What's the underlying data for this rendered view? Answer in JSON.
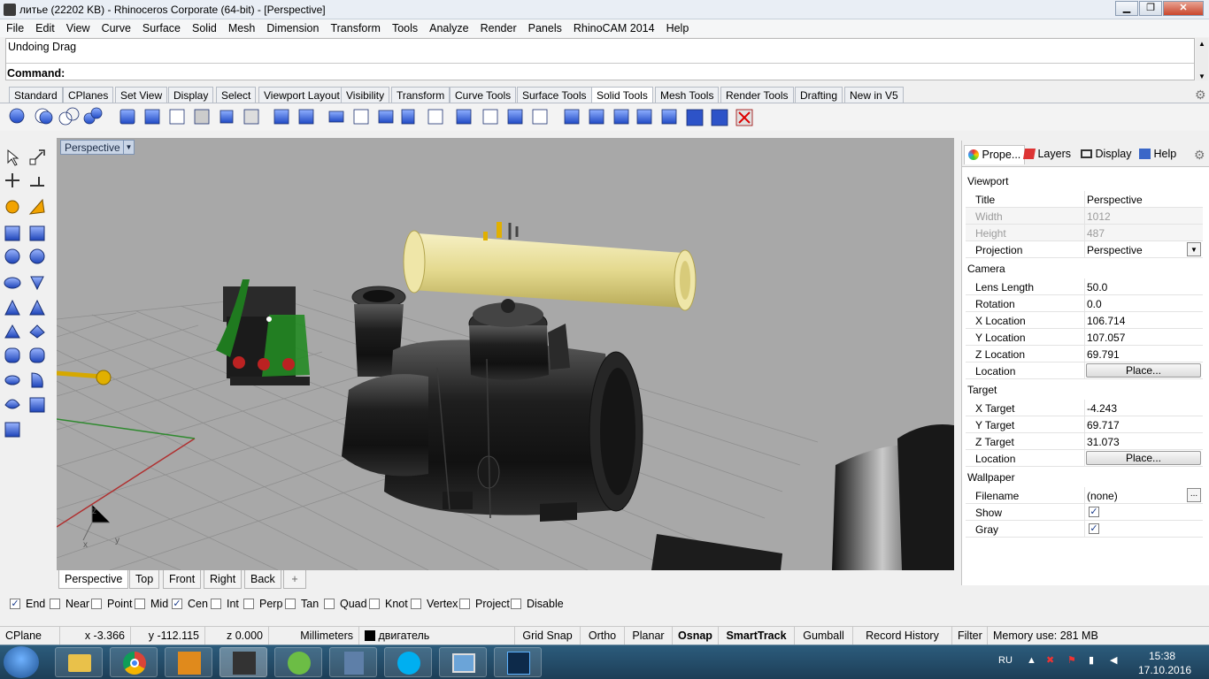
{
  "window": {
    "title": "литье (22202 KB) - Rhinoceros Corporate (64-bit) - [Perspective]",
    "controls": [
      "minimize",
      "maximize",
      "close"
    ]
  },
  "menu": [
    "File",
    "Edit",
    "View",
    "Curve",
    "Surface",
    "Solid",
    "Mesh",
    "Dimension",
    "Transform",
    "Tools",
    "Analyze",
    "Render",
    "Panels",
    "RhinoCAM 2014",
    "Help"
  ],
  "command": {
    "history": "Undoing Drag",
    "prompt": "Command:"
  },
  "toolbar_tabs": [
    "Standard",
    "CPlanes",
    "Set View",
    "Display",
    "Select",
    "Viewport Layout",
    "Visibility",
    "Transform",
    "Curve Tools",
    "Surface Tools",
    "Solid Tools",
    "Mesh Tools",
    "Render Tools",
    "Drafting",
    "New in V5"
  ],
  "active_toolbar_tab": "Solid Tools",
  "viewport": {
    "title": "Perspective",
    "tabs": [
      "Perspective",
      "Top",
      "Front",
      "Right",
      "Back"
    ],
    "active_tab": "Perspective",
    "add_tab_glyph": "+",
    "axis_labels": {
      "z": "z",
      "y": "y",
      "x": "x"
    }
  },
  "panel": {
    "tabs": [
      "Prope...",
      "Layers",
      "Display",
      "Help"
    ],
    "sections": {
      "viewport": {
        "header": "Viewport",
        "title_label": "Title",
        "title_value": "Perspective",
        "width_label": "Width",
        "width_value": "1012",
        "height_label": "Height",
        "height_value": "487",
        "projection_label": "Projection",
        "projection_value": "Perspective"
      },
      "camera": {
        "header": "Camera",
        "lens_label": "Lens Length",
        "lens_value": "50.0",
        "rotation_label": "Rotation",
        "rotation_value": "0.0",
        "x_label": "X Location",
        "x_value": "106.714",
        "y_label": "Y Location",
        "y_value": "107.057",
        "z_label": "Z Location",
        "z_value": "69.791",
        "location_label": "Location",
        "place_button": "Place..."
      },
      "target": {
        "header": "Target",
        "x_label": "X Target",
        "x_value": "-4.243",
        "y_label": "Y Target",
        "y_value": "69.717",
        "z_label": "Z Target",
        "z_value": "31.073",
        "location_label": "Location",
        "place_button": "Place..."
      },
      "wallpaper": {
        "header": "Wallpaper",
        "filename_label": "Filename",
        "filename_value": "(none)",
        "browse_button": "...",
        "show_label": "Show",
        "show_checked": true,
        "gray_label": "Gray",
        "gray_checked": true
      }
    }
  },
  "osnap": [
    {
      "label": "End",
      "checked": true
    },
    {
      "label": "Near",
      "checked": false
    },
    {
      "label": "Point",
      "checked": false
    },
    {
      "label": "Mid",
      "checked": false
    },
    {
      "label": "Cen",
      "checked": true
    },
    {
      "label": "Int",
      "checked": false
    },
    {
      "label": "Perp",
      "checked": false
    },
    {
      "label": "Tan",
      "checked": false
    },
    {
      "label": "Quad",
      "checked": false
    },
    {
      "label": "Knot",
      "checked": false
    },
    {
      "label": "Vertex",
      "checked": false
    },
    {
      "label": "Project",
      "checked": false
    },
    {
      "label": "Disable",
      "checked": false
    }
  ],
  "status": {
    "cplane": "CPlane",
    "x": "x -3.366",
    "y": "y -112.115",
    "z": "z 0.000",
    "units": "Millimeters",
    "layer": "двигатель",
    "grid_snap": "Grid Snap",
    "ortho": "Ortho",
    "planar": "Planar",
    "osnap": "Osnap",
    "smarttrack": "SmartTrack",
    "gumball": "Gumball",
    "record_history": "Record History",
    "filter": "Filter",
    "memory": "Memory use: 281 MB"
  },
  "taskbar": {
    "apps": [
      "start",
      "explorer",
      "chrome",
      "inventor",
      "rhino",
      "utorrent",
      "autodesk",
      "skype",
      "photos",
      "photoshop"
    ],
    "lang": "RU",
    "time": "15:38",
    "date": "17.10.2016"
  },
  "colors": {
    "viewport_bg": "#a8a8a8",
    "grid_x_axis": "#b03030",
    "grid_y_axis": "#2f8a2f",
    "selected_yellow": "#e9e2a0"
  }
}
